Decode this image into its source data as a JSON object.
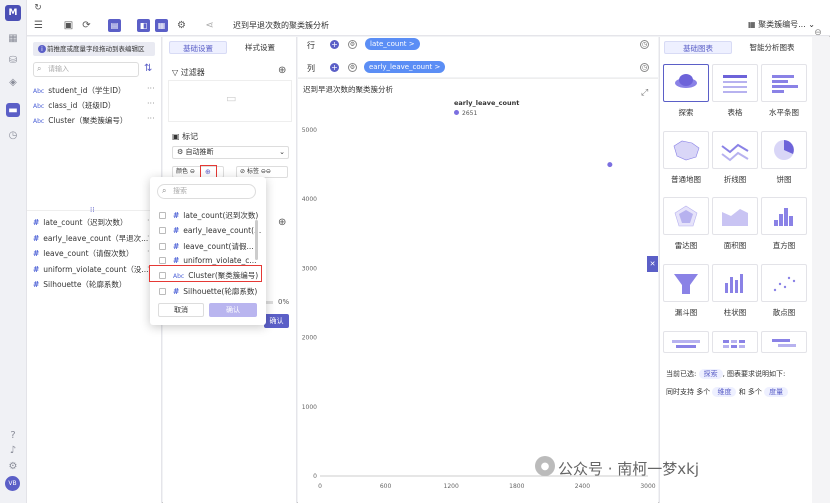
{
  "app": {
    "logo_text": "M",
    "avatar_text": "VB"
  },
  "toolbar": {
    "chart_title": "迟到早退次数的聚类簇分析",
    "dataset_label": "聚类簇编号..."
  },
  "field_panel": {
    "banner_text": "前推度或度量字段拖动到表编辑区",
    "search_placeholder": "请输入",
    "dimensions": [
      {
        "type": "Abc",
        "label": "student_id（学生ID）"
      },
      {
        "type": "Abc",
        "label": "class_id（班级ID）"
      },
      {
        "type": "Abc",
        "label": "Cluster（聚类簇编号）"
      }
    ],
    "measures": [
      {
        "label": "late_count（迟到次数）"
      },
      {
        "label": "early_leave_count（早退次..."
      },
      {
        "label": "leave_count（请假次数）"
      },
      {
        "label": "uniform_violate_count（没..."
      },
      {
        "label": "Silhouette（轮廓系数）"
      }
    ]
  },
  "config_panel": {
    "tabs": [
      "基础设置",
      "样式设置"
    ],
    "filter_title": "过滤器",
    "marks_title": "标记",
    "auto_select": "自动推断",
    "color_chip": "颜色",
    "label_chip": "标签",
    "percent": "0%",
    "confirm": "确认"
  },
  "popup": {
    "search_placeholder": "搜索",
    "items": [
      {
        "type": "#",
        "label": "late_count(迟到次数)"
      },
      {
        "type": "#",
        "label": "early_leave_count(..."
      },
      {
        "type": "#",
        "label": "leave_count(请假..."
      },
      {
        "type": "#",
        "label": "uniform_violate_c..."
      },
      {
        "type": "Abc",
        "label": "Cluster(聚类簇编号)"
      },
      {
        "type": "#",
        "label": "Silhouette(轮廓系数)"
      }
    ],
    "cancel": "取消",
    "ok": "确认"
  },
  "shelves": {
    "row_label": "行",
    "col_label": "列",
    "row_pill": "late_count >",
    "col_pill": "early_leave_count >"
  },
  "chart_data": {
    "type": "scatter",
    "title": "迟到早退次数的聚类簇分析",
    "xlabel": "early_leave_count",
    "ylabel": "",
    "legend": [
      {
        "name": "2651",
        "color": "#7b6fe0"
      }
    ],
    "xlim": [
      0,
      3000
    ],
    "ylim": [
      0,
      5000
    ],
    "xticks": [
      0,
      600,
      1200,
      1800,
      2400,
      3000
    ],
    "yticks": [
      0,
      1000,
      2000,
      3000,
      4000,
      5000
    ],
    "points": [
      {
        "x": 2651,
        "y": 4500
      }
    ],
    "grid": false,
    "legend_position": "top"
  },
  "right_panel": {
    "tabs": [
      "基础图表",
      "智能分析图表"
    ],
    "charts": [
      "探索",
      "表格",
      "水平条图",
      "普通地图",
      "折线图",
      "饼图",
      "雷达图",
      "面积图",
      "直方图",
      "漏斗图",
      "柱状图",
      "散点图"
    ],
    "hint_line1_prefix": "当前已选:",
    "hint_selected": "探索",
    "hint_line1_suffix": ", 图表要求说明如下:",
    "hint_line2_prefix": "同时支持 多个",
    "hint_dim": "维度",
    "hint_mid": "和 多个",
    "hint_measure": "度量"
  },
  "watermark": {
    "text": "公众号 · 南柯一梦xkj"
  },
  "colors": {
    "accent": "#5b5fc7",
    "pill": "#5b8ef5",
    "highlight": "#e53935",
    "point": "#7b6fe0"
  }
}
